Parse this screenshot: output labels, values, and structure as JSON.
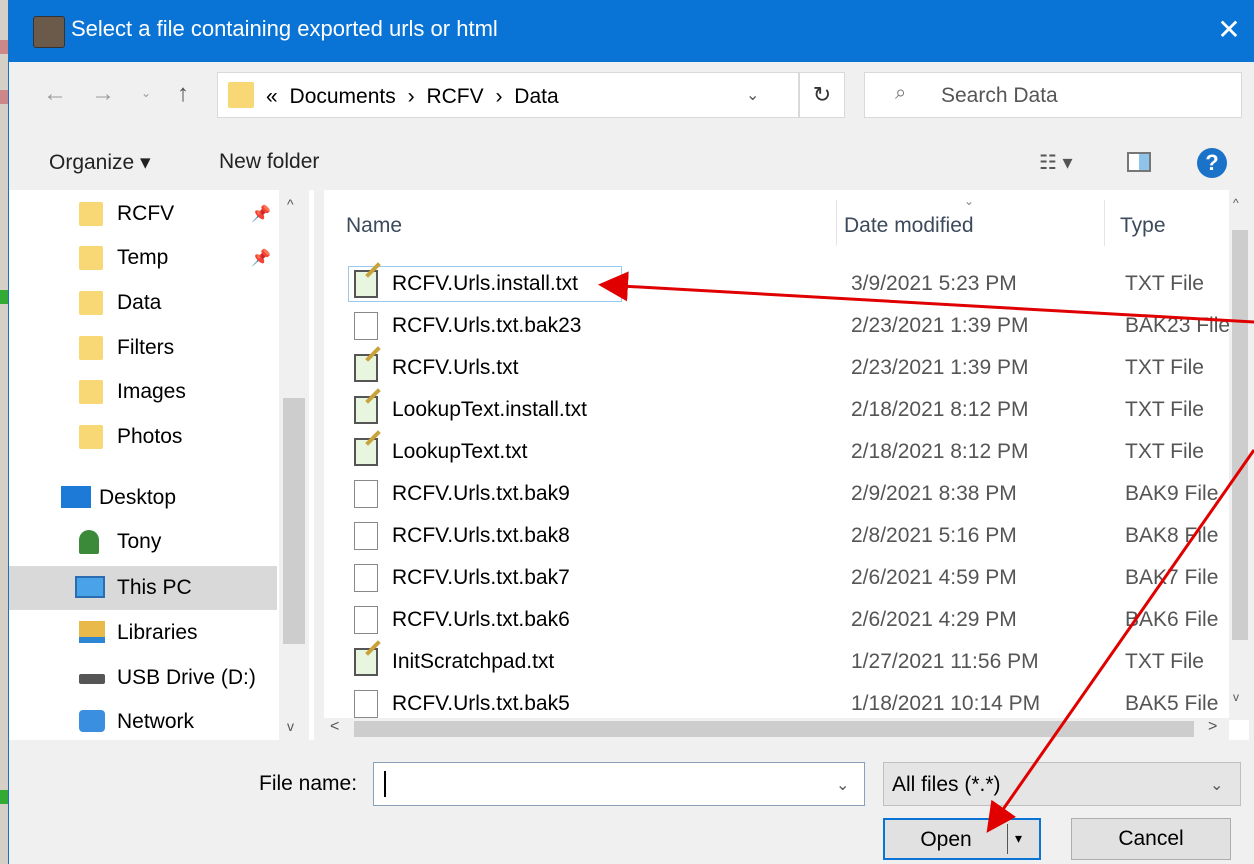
{
  "window": {
    "title": "Select a file containing exported urls or html",
    "close": "✕"
  },
  "nav": {
    "back": "←",
    "forward": "→",
    "recent": "⌄",
    "up": "↑"
  },
  "address": {
    "overflow": "«",
    "crumbs": [
      "Documents",
      "RCFV",
      "Data"
    ],
    "separator": "›",
    "dropdown": "⌄",
    "refresh": "↻"
  },
  "search": {
    "icon": "⌕",
    "placeholder": "Search Data"
  },
  "toolbar": {
    "organize": "Organize ▾",
    "new_folder": "New folder",
    "view": "☷ ▾",
    "help": "?"
  },
  "sidebar": {
    "items": [
      {
        "label": "RCFV",
        "icon": "folder-icon",
        "pinned": true
      },
      {
        "label": "Temp",
        "icon": "folder-icon",
        "pinned": true
      },
      {
        "label": "Data",
        "icon": "folder-icon"
      },
      {
        "label": "Filters",
        "icon": "folder-icon"
      },
      {
        "label": "Images",
        "icon": "folder-icon"
      },
      {
        "label": "Photos",
        "icon": "folder-icon"
      },
      {
        "label": "Desktop",
        "icon": "desktop-icon"
      },
      {
        "label": "Tony",
        "icon": "user-icon"
      },
      {
        "label": "This PC",
        "icon": "computer-icon",
        "selected": true
      },
      {
        "label": "Libraries",
        "icon": "libraries-icon"
      },
      {
        "label": "USB Drive (D:)",
        "icon": "drive-icon"
      },
      {
        "label": "Network",
        "icon": "network-icon"
      }
    ],
    "pin_glyph": "📌",
    "scroll_up": "^",
    "scroll_down": "v"
  },
  "files": {
    "columns": {
      "name": "Name",
      "date": "Date modified",
      "type": "Type",
      "sort_indicator": "⌄"
    },
    "rows": [
      {
        "name": "RCFV.Urls.install.txt",
        "date": "3/9/2021 5:23 PM",
        "type": "TXT File",
        "icon": "text-file-icon"
      },
      {
        "name": "RCFV.Urls.txt.bak23",
        "date": "2/23/2021 1:39 PM",
        "type": "BAK23 File",
        "icon": "blank-file-icon"
      },
      {
        "name": "RCFV.Urls.txt",
        "date": "2/23/2021 1:39 PM",
        "type": "TXT File",
        "icon": "text-file-icon"
      },
      {
        "name": "LookupText.install.txt",
        "date": "2/18/2021 8:12 PM",
        "type": "TXT File",
        "icon": "text-file-icon"
      },
      {
        "name": "LookupText.txt",
        "date": "2/18/2021 8:12 PM",
        "type": "TXT File",
        "icon": "text-file-icon"
      },
      {
        "name": "RCFV.Urls.txt.bak9",
        "date": "2/9/2021 8:38 PM",
        "type": "BAK9 File",
        "icon": "blank-file-icon"
      },
      {
        "name": "RCFV.Urls.txt.bak8",
        "date": "2/8/2021 5:16 PM",
        "type": "BAK8 File",
        "icon": "blank-file-icon"
      },
      {
        "name": "RCFV.Urls.txt.bak7",
        "date": "2/6/2021 4:59 PM",
        "type": "BAK7 File",
        "icon": "blank-file-icon"
      },
      {
        "name": "RCFV.Urls.txt.bak6",
        "date": "2/6/2021 4:29 PM",
        "type": "BAK6 File",
        "icon": "blank-file-icon"
      },
      {
        "name": "InitScratchpad.txt",
        "date": "1/27/2021 11:56 PM",
        "type": "TXT File",
        "icon": "text-file-icon"
      },
      {
        "name": "RCFV.Urls.txt.bak5",
        "date": "1/18/2021 10:14 PM",
        "type": "BAK5 File",
        "icon": "blank-file-icon"
      }
    ],
    "scroll_up": "^",
    "scroll_down": "v",
    "scroll_left": "<",
    "scroll_right": ">"
  },
  "bottom": {
    "file_name_label": "File name:",
    "file_name_value": "",
    "file_name_dropdown": "⌄",
    "filter": "All files (*.*)",
    "filter_dropdown": "⌄",
    "open": "Open",
    "open_arrow": "▾",
    "cancel": "Cancel"
  },
  "colors": {
    "titlebar": "#0a74d6",
    "annotation": "#e00000",
    "selection": "#d9d9d9",
    "folder": "#f8d775"
  }
}
